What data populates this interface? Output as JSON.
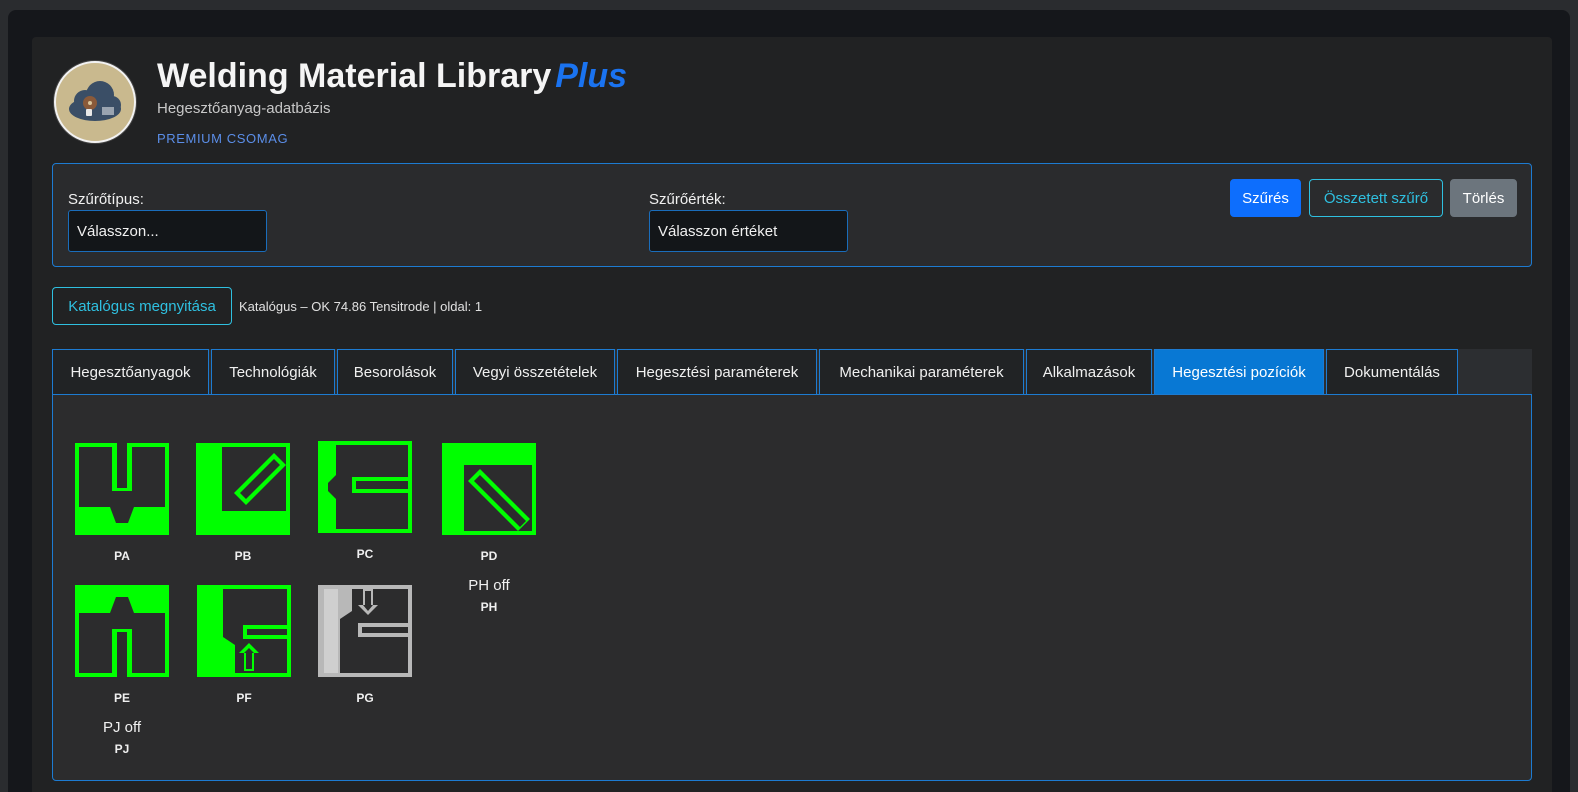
{
  "header": {
    "title": "Welding Material Library",
    "title_plus": "Plus",
    "subtitle": "Hegesztőanyag-adatbázis",
    "package": "PREMIUM CSOMAG"
  },
  "filter": {
    "type_label": "Szűrőtípus:",
    "type_value": "Válasszon...",
    "value_label": "Szűrőérték:",
    "value_value": "Válasszon értéket",
    "filter_button": "Szűrés",
    "compound_button": "Összetett szűrő",
    "clear_button": "Törlés"
  },
  "catalog": {
    "open_button": "Katalógus megnyitása",
    "info": "Katalógus – OK 74.86 Tensitrode | oldal: 1"
  },
  "tabs": [
    {
      "label": "Hegesztőanyagok"
    },
    {
      "label": "Technológiák"
    },
    {
      "label": "Besorolások"
    },
    {
      "label": "Vegyi összetételek"
    },
    {
      "label": "Hegesztési paraméterek"
    },
    {
      "label": "Mechanikai paraméterek"
    },
    {
      "label": "Alkalmazások"
    },
    {
      "label": "Hegesztési pozíciók",
      "active": true
    },
    {
      "label": "Dokumentálás"
    }
  ],
  "positions": [
    {
      "code": "PA"
    },
    {
      "code": "PB"
    },
    {
      "code": "PC"
    },
    {
      "code": "PD",
      "off_label": "PH off",
      "sub_code": "PH"
    },
    {
      "code": "PE",
      "off_label": "PJ off",
      "sub_code": "PJ"
    },
    {
      "code": "PF"
    },
    {
      "code": "PG"
    }
  ],
  "colors": {
    "accent": "#0d6efd",
    "border": "#1d7bd1",
    "outline": "#2fc0e0",
    "active_tab": "#0878d4",
    "position_green": "#00ff00",
    "position_gray": "#b8b8b8"
  }
}
